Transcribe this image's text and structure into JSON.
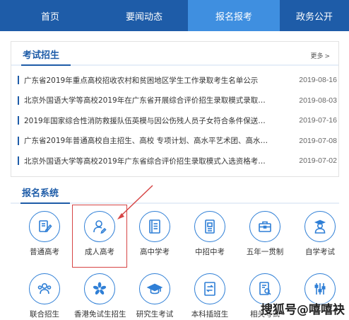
{
  "nav": {
    "items": [
      {
        "label": "首页"
      },
      {
        "label": "要闻动态"
      },
      {
        "label": "报名报考"
      },
      {
        "label": "政务公开"
      }
    ],
    "active_index": 2
  },
  "exam_section": {
    "title": "考试招生",
    "more_label": "更多",
    "more_icon": "chevron-right-icon",
    "news": [
      {
        "title": "广东省2019年重点高校招收农村和贫困地区学生工作录取考生名单公示",
        "date": "2019-08-16"
      },
      {
        "title": "北京外国语大学等高校2019年在广东省开展综合评价招生录取模式录取考生...",
        "date": "2019-08-03"
      },
      {
        "title": "2019年国家综合性消防救援队伍英模与因公伤残人员子女符合条件保送中国...",
        "date": "2019-07-16"
      },
      {
        "title": "广东省2019年普通高校自主招生、高校 专项计划、高水平艺术团、高水平 运...",
        "date": "2019-07-08"
      },
      {
        "title": "北京外国语大学等高校2019年广东省综合评价招生录取模式入选资格考生名...",
        "date": "2019-07-02"
      }
    ]
  },
  "system_section": {
    "title": "报名系统",
    "tiles": [
      {
        "label": "普通高考",
        "icon": "pen-document-icon"
      },
      {
        "label": "成人高考",
        "icon": "adult-user-icon"
      },
      {
        "label": "高中学考",
        "icon": "notebook-icon"
      },
      {
        "label": "中招中考",
        "icon": "id-document-icon"
      },
      {
        "label": "五年一贯制",
        "icon": "briefcase-icon"
      },
      {
        "label": "自学考试",
        "icon": "graduate-person-icon"
      },
      {
        "label": "联合招生",
        "icon": "group-users-icon"
      },
      {
        "label": "香港免试生招生",
        "icon": "bauhinia-flower-icon"
      },
      {
        "label": "研究生考试",
        "icon": "graduation-cap-icon"
      },
      {
        "label": "本科插班生",
        "icon": "transfer-document-icon"
      },
      {
        "label": "相关考试",
        "icon": "search-document-icon"
      },
      {
        "label": "",
        "icon": "settings-sliders-icon"
      }
    ]
  },
  "colors": {
    "nav_bg": "#1e5ca8",
    "nav_active": "#3f8fe0",
    "accent": "#2f7fd6",
    "highlight_red": "#d64545"
  },
  "watermark": "搜狐号@嘻嘻袂"
}
